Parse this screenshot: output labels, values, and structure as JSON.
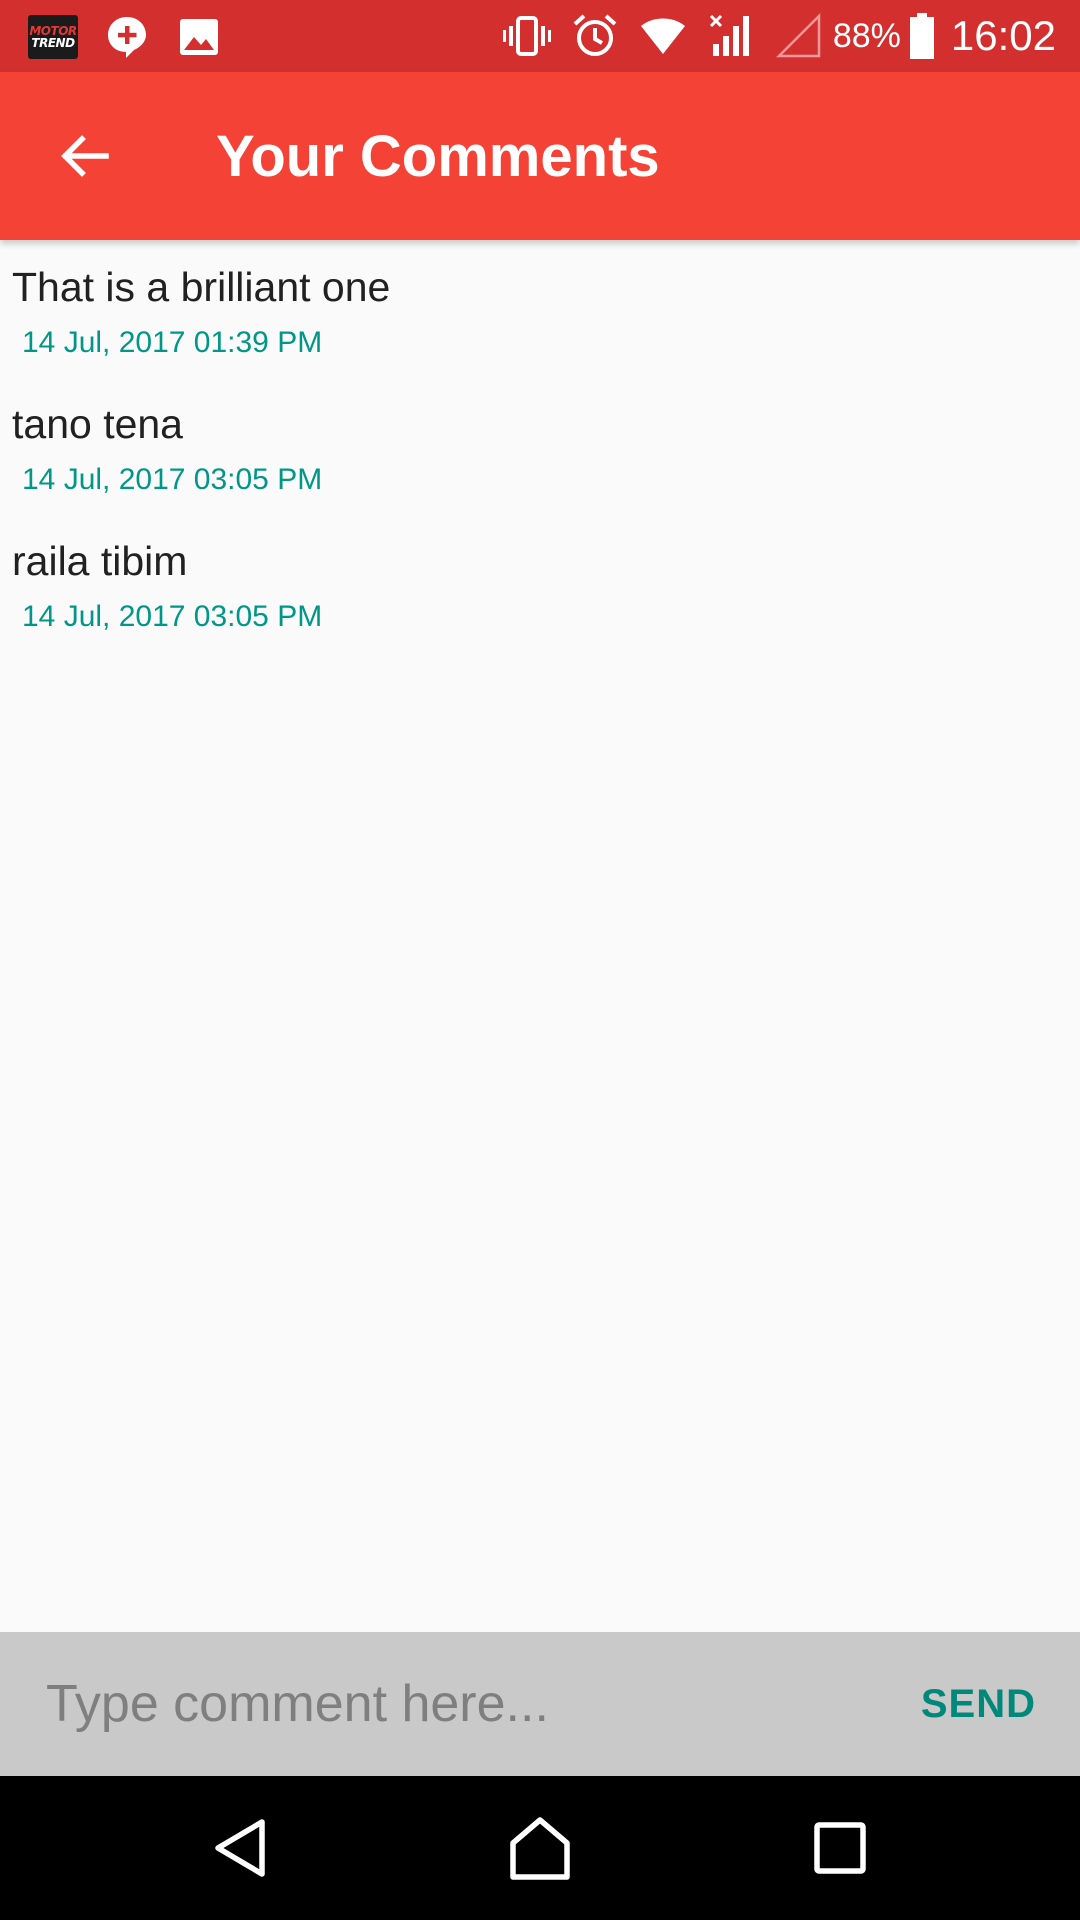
{
  "status_bar": {
    "app_logo": {
      "line1": "MOTOR",
      "line2": "TREND"
    },
    "notification_icons": [
      "message-plus-icon",
      "image-icon"
    ],
    "system_icons": [
      "vibrate-icon",
      "alarm-icon",
      "wifi-icon",
      "cell-signal-icon",
      "no-sim-signal-icon"
    ],
    "battery_percent": "88%",
    "time": "16:02"
  },
  "app_bar": {
    "back_icon": "arrow-back-icon",
    "title": "Your Comments"
  },
  "comments": [
    {
      "text": "That is a brilliant one",
      "date": "14 Jul, 2017 01:39 PM"
    },
    {
      "text": "tano tena",
      "date": "14 Jul, 2017 03:05 PM"
    },
    {
      "text": "raila tibim",
      "date": "14 Jul, 2017 03:05 PM"
    }
  ],
  "input_bar": {
    "value": "",
    "placeholder": "Type comment here...",
    "send_label": "SEND"
  },
  "nav_bar": {
    "buttons": [
      "back-triangle-icon",
      "home-icon",
      "recents-icon"
    ]
  },
  "colors": {
    "status_bar": "#d32f2f",
    "app_bar": "#f44336",
    "date_text": "#009688",
    "send_text": "#00897b",
    "input_bar": "#c9c9c9"
  }
}
